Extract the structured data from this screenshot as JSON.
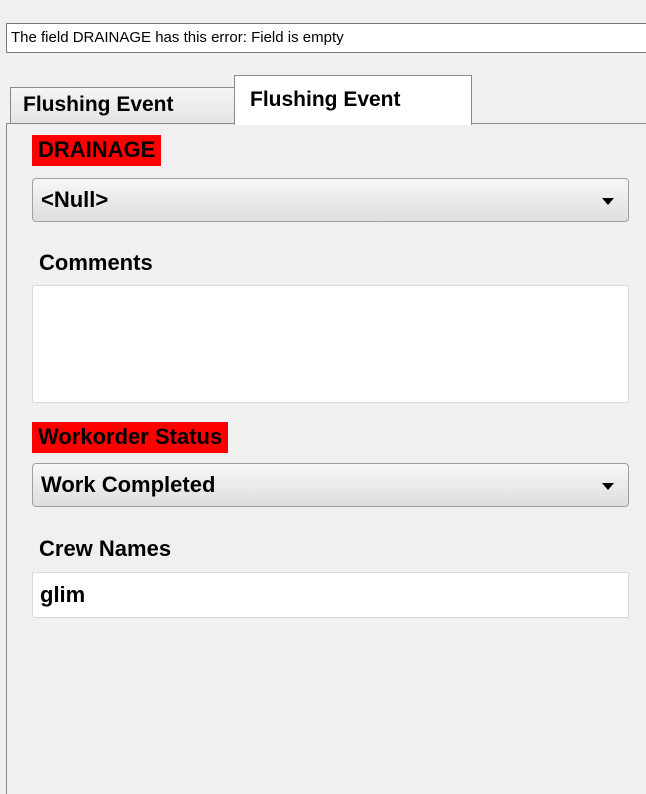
{
  "status_message": "The field DRAINAGE has this error: Field is empty",
  "tabs": [
    {
      "label": "Flushing Event",
      "active": false
    },
    {
      "label": "Flushing Event",
      "active": true
    }
  ],
  "form": {
    "drainage": {
      "label": "DRAINAGE",
      "value": "<Null>",
      "error": true,
      "icon": "chevron-down-icon"
    },
    "comments": {
      "label": "Comments",
      "value": ""
    },
    "workorder_status": {
      "label": "Workorder Status",
      "value": "Work Completed",
      "error": true,
      "icon": "chevron-down-icon"
    },
    "crew_names": {
      "label": "Crew Names",
      "value": "glim"
    }
  },
  "colors": {
    "error_highlight": "#ff0000",
    "panel_bg": "#f0f0f0",
    "field_bg": "#ffffff"
  }
}
